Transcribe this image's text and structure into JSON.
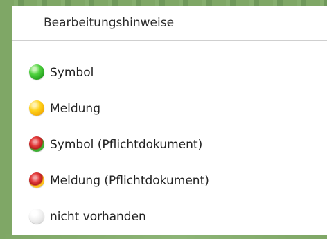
{
  "menu": {
    "title": "Bearbeitungshinweise",
    "items": [
      {
        "label": "Symbol",
        "icon": "green-status-dot",
        "color": "#3fbf33"
      },
      {
        "label": "Meldung",
        "icon": "yellow-status-dot",
        "color": "#ffcc00"
      },
      {
        "label": "Symbol (Pflichtdokument)",
        "icon": "red-green-status-dot",
        "color": "#e53c3c"
      },
      {
        "label": "Meldung (Pflichtdokument)",
        "icon": "red-yellow-status-dot",
        "color": "#e53c3c"
      },
      {
        "label": "nicht vorhanden",
        "icon": "grey-status-dot",
        "color": "#dddddd"
      }
    ]
  },
  "colors": {
    "background": "#7fa766",
    "menu_background": "#ffffff",
    "text": "#222222"
  }
}
